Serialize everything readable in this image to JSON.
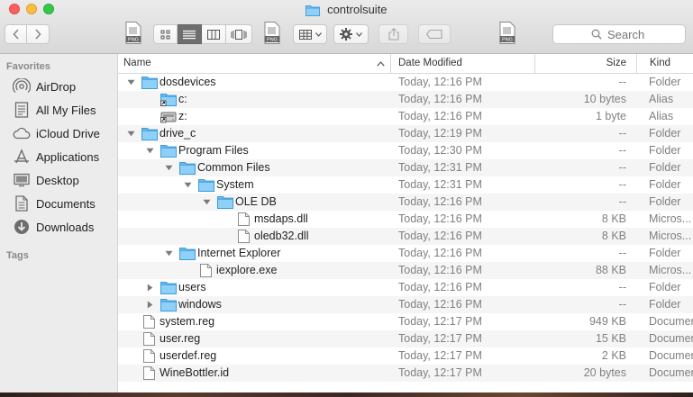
{
  "window": {
    "title": "controlsuite"
  },
  "toolbar": {
    "png_label": "PNG",
    "search_placeholder": "Search"
  },
  "sidebar": {
    "favorites_label": "Favorites",
    "tags_label": "Tags",
    "items": [
      {
        "label": "AirDrop",
        "icon": "airdrop-icon"
      },
      {
        "label": "All My Files",
        "icon": "all-files-icon"
      },
      {
        "label": "iCloud Drive",
        "icon": "cloud-icon"
      },
      {
        "label": "Applications",
        "icon": "applications-icon"
      },
      {
        "label": "Desktop",
        "icon": "desktop-icon"
      },
      {
        "label": "Documents",
        "icon": "documents-icon"
      },
      {
        "label": "Downloads",
        "icon": "downloads-icon"
      }
    ]
  },
  "columns": {
    "name": "Name",
    "date": "Date Modified",
    "size": "Size",
    "kind": "Kind"
  },
  "rows": [
    {
      "name": "dosdevices",
      "type": "folder",
      "depth": 0,
      "disclosure": "open",
      "date": "Today, 12:16 PM",
      "size": "--",
      "kind": "Folder"
    },
    {
      "name": "c:",
      "type": "alias-folder",
      "depth": 1,
      "disclosure": "none",
      "date": "Today, 12:16 PM",
      "size": "10 bytes",
      "kind": "Alias"
    },
    {
      "name": "z:",
      "type": "alias-drive",
      "depth": 1,
      "disclosure": "none",
      "date": "Today, 12:16 PM",
      "size": "1 byte",
      "kind": "Alias"
    },
    {
      "name": "drive_c",
      "type": "folder",
      "depth": 0,
      "disclosure": "open",
      "date": "Today, 12:19 PM",
      "size": "--",
      "kind": "Folder"
    },
    {
      "name": "Program Files",
      "type": "folder",
      "depth": 1,
      "disclosure": "open",
      "date": "Today, 12:30 PM",
      "size": "--",
      "kind": "Folder"
    },
    {
      "name": "Common Files",
      "type": "folder",
      "depth": 2,
      "disclosure": "open",
      "date": "Today, 12:31 PM",
      "size": "--",
      "kind": "Folder"
    },
    {
      "name": "System",
      "type": "folder",
      "depth": 3,
      "disclosure": "open",
      "date": "Today, 12:31 PM",
      "size": "--",
      "kind": "Folder"
    },
    {
      "name": "OLE DB",
      "type": "folder",
      "depth": 4,
      "disclosure": "open",
      "date": "Today, 12:16 PM",
      "size": "--",
      "kind": "Folder"
    },
    {
      "name": "msdaps.dll",
      "type": "file",
      "depth": 5,
      "disclosure": "none",
      "date": "Today, 12:16 PM",
      "size": "8 KB",
      "kind": "Micros..."
    },
    {
      "name": "oledb32.dll",
      "type": "file",
      "depth": 5,
      "disclosure": "none",
      "date": "Today, 12:16 PM",
      "size": "8 KB",
      "kind": "Micros..."
    },
    {
      "name": "Internet Explorer",
      "type": "folder",
      "depth": 2,
      "disclosure": "open",
      "date": "Today, 12:16 PM",
      "size": "--",
      "kind": "Folder"
    },
    {
      "name": "iexplore.exe",
      "type": "file",
      "depth": 3,
      "disclosure": "none",
      "date": "Today, 12:16 PM",
      "size": "88 KB",
      "kind": "Micros..."
    },
    {
      "name": "users",
      "type": "folder",
      "depth": 1,
      "disclosure": "closed",
      "date": "Today, 12:16 PM",
      "size": "--",
      "kind": "Folder"
    },
    {
      "name": "windows",
      "type": "folder",
      "depth": 1,
      "disclosure": "closed",
      "date": "Today, 12:16 PM",
      "size": "--",
      "kind": "Folder"
    },
    {
      "name": "system.reg",
      "type": "file",
      "depth": 0,
      "disclosure": "none",
      "date": "Today, 12:17 PM",
      "size": "949 KB",
      "kind": "Document"
    },
    {
      "name": "user.reg",
      "type": "file",
      "depth": 0,
      "disclosure": "none",
      "date": "Today, 12:17 PM",
      "size": "15 KB",
      "kind": "Document"
    },
    {
      "name": "userdef.reg",
      "type": "file",
      "depth": 0,
      "disclosure": "none",
      "date": "Today, 12:17 PM",
      "size": "2 KB",
      "kind": "Document"
    },
    {
      "name": "WineBottler.id",
      "type": "file",
      "depth": 0,
      "disclosure": "none",
      "date": "Today, 12:17 PM",
      "size": "20 bytes",
      "kind": "Document"
    }
  ]
}
